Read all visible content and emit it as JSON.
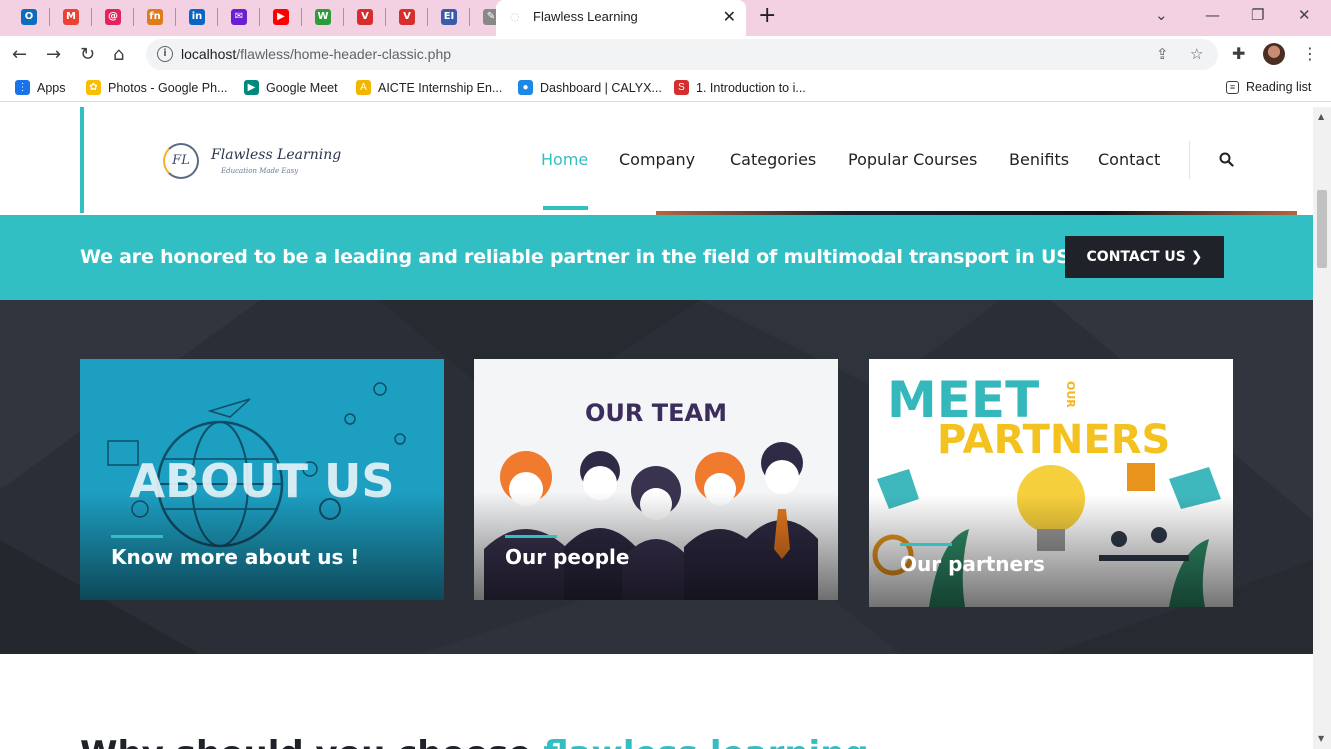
{
  "browser": {
    "pinned_tabs": [
      {
        "icon": "outlook-icon",
        "color": "#0f6cbd",
        "glyph": "O"
      },
      {
        "icon": "gmail-icon",
        "color": "#ea4335",
        "glyph": "M"
      },
      {
        "icon": "spiral-icon",
        "color": "#e0245e",
        "glyph": "@"
      },
      {
        "icon": "fn-icon",
        "color": "#e07b1a",
        "glyph": "fn"
      },
      {
        "icon": "linkedin-icon",
        "color": "#0a66c2",
        "glyph": "in"
      },
      {
        "icon": "mail-icon",
        "color": "#6a1fd1",
        "glyph": "✉"
      },
      {
        "icon": "youtube-icon",
        "color": "#ff0000",
        "glyph": "▶"
      },
      {
        "icon": "w-icon",
        "color": "#2c9b3a",
        "glyph": "W"
      },
      {
        "icon": "v-icon",
        "color": "#d62d2d",
        "glyph": "V"
      },
      {
        "icon": "v-icon",
        "color": "#d62d2d",
        "glyph": "V"
      },
      {
        "icon": "ei-icon",
        "color": "#3b5aa8",
        "glyph": "EI"
      },
      {
        "icon": "quill-icon",
        "color": "#888888",
        "glyph": "✎"
      }
    ],
    "active_tab_title": "Flawless Learning",
    "url_host": "localhost",
    "url_path": "/flawless/home-header-classic.php",
    "bookmarks": [
      {
        "label": "Apps",
        "icon": "apps-grid-icon",
        "color": "#1a73e8",
        "glyph": "⋮"
      },
      {
        "label": "Photos - Google Ph...",
        "icon": "google-photos-icon",
        "color": "#fbbc04",
        "glyph": "✿"
      },
      {
        "label": "Google Meet",
        "icon": "google-meet-icon",
        "color": "#00897b",
        "glyph": "▶"
      },
      {
        "label": "AICTE Internship En...",
        "icon": "aicte-icon",
        "color": "#f2b600",
        "glyph": "A"
      },
      {
        "label": "Dashboard | CALYX...",
        "icon": "calyx-icon",
        "color": "#1e88e5",
        "glyph": "●"
      },
      {
        "label": "1. Introduction to i...",
        "icon": "course-icon",
        "color": "#d32f2f",
        "glyph": "S"
      }
    ],
    "reading_list": "Reading list"
  },
  "site": {
    "logo_name": "Flawless Learning",
    "logo_tagline": "Education Made Easy",
    "logo_mark": "FL",
    "nav": [
      "Home",
      "Company",
      "Categories",
      "Popular Courses",
      "Benifits",
      "Contact"
    ],
    "nav_active": "Home",
    "banner_text": "We are honored to be a leading and reliable partner in the field of multimodal transport in US",
    "cta_label": "CONTACT US",
    "cards": [
      {
        "art_title": "ABOUT US",
        "label": "Know more about us !"
      },
      {
        "art_title": "OUR TEAM",
        "label": "Our people"
      },
      {
        "art_title_1": "MEET",
        "art_title_our": "OUR",
        "art_title_2": "PARTNERS",
        "label": "Our partners"
      }
    ],
    "next_heading": "Why should you choose",
    "next_heading_highlight": "flawless learning"
  },
  "colors": {
    "accent": "#32bfc4",
    "dark_section": "#2a2e36",
    "cta_bg": "#1f2329",
    "tab_bar": "#f3d1e2"
  }
}
